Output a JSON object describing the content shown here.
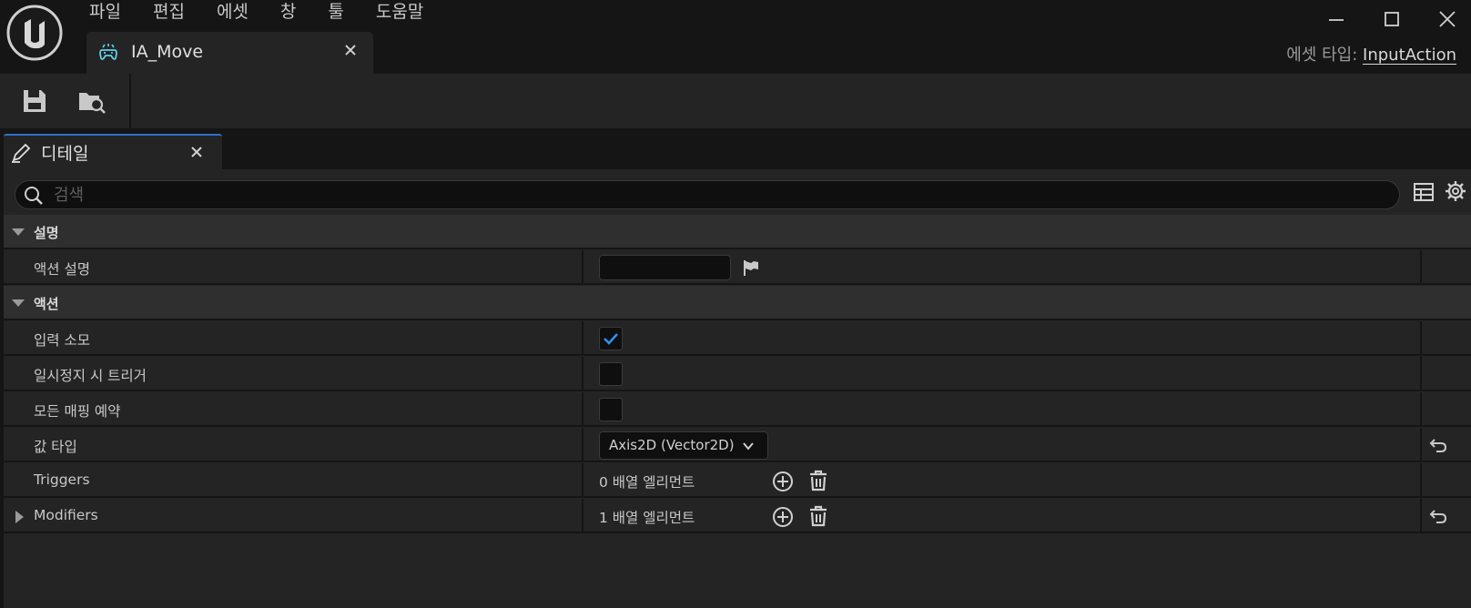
{
  "menu": [
    "파일",
    "편집",
    "에셋",
    "창",
    "툴",
    "도움말"
  ],
  "document_tab": {
    "label": "IA_Move"
  },
  "asset_type": {
    "label": "에셋 타입:",
    "value": "InputAction"
  },
  "details_tab": {
    "label": "디테일"
  },
  "search": {
    "placeholder": "검색",
    "value": ""
  },
  "categories": {
    "description": {
      "label": "설명"
    },
    "action": {
      "label": "액션"
    }
  },
  "properties": {
    "action_description": {
      "label": "액션 설명",
      "value": ""
    },
    "consume_input": {
      "label": "입력 소모",
      "checked": true
    },
    "trigger_when_paused": {
      "label": "일시정지 시 트리거",
      "checked": false
    },
    "reserve_all_mappings": {
      "label": "모든 매핑 예약",
      "checked": false
    },
    "value_type": {
      "label": "값 타입",
      "value": "Axis2D (Vector2D)"
    },
    "triggers": {
      "label": "Triggers",
      "count": "0 배열 엘리먼트"
    },
    "modifiers": {
      "label": "Modifiers",
      "count": "1 배열 엘리먼트"
    }
  },
  "colors": {
    "accent": "#2a72c8",
    "check": "#2f8ff0"
  }
}
